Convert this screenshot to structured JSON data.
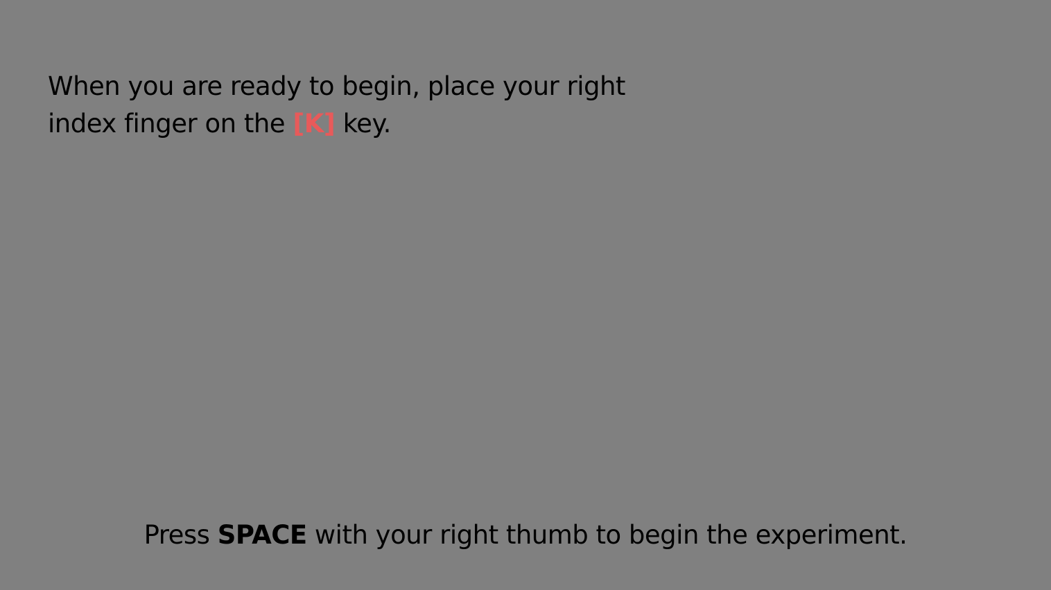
{
  "colors": {
    "background": "#808080",
    "text": "#000000",
    "key_highlight": "#e85a5a"
  },
  "instruction": {
    "line1": "When you are ready to begin, place your right",
    "line2_before": "index finger on the ",
    "key": "[K]",
    "line2_after": " key."
  },
  "prompt": {
    "before": "Press ",
    "key": "SPACE",
    "after": " with your right thumb to begin the experiment."
  }
}
